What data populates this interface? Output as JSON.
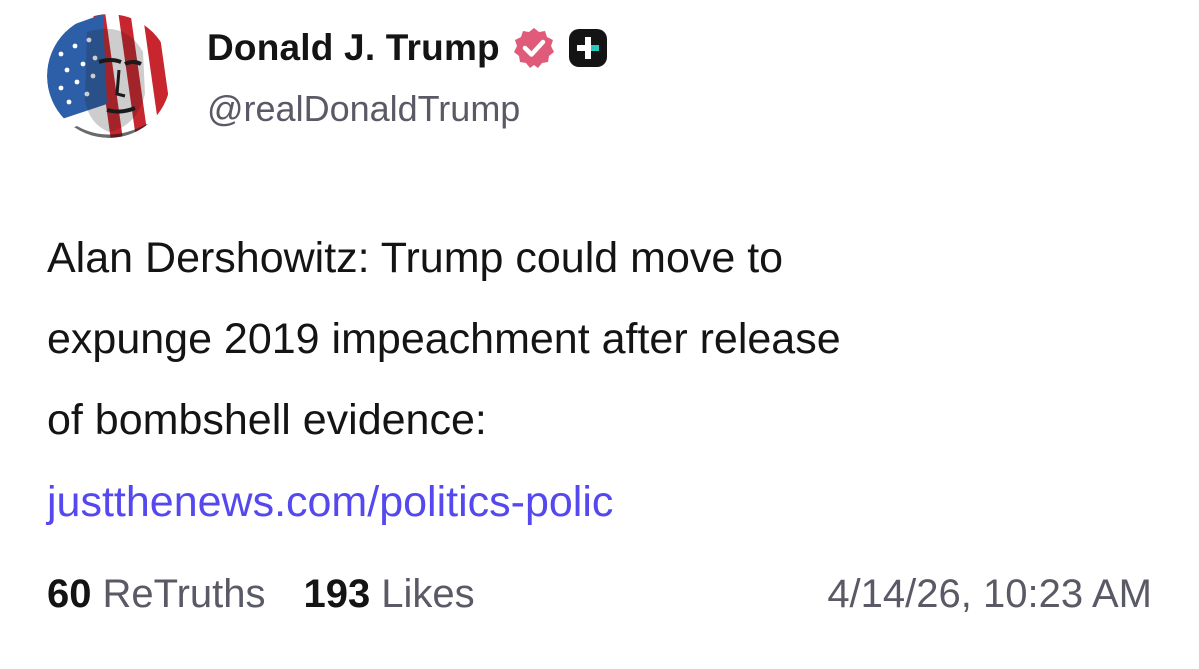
{
  "author": {
    "display_name": "Donald J. Trump",
    "handle": "@realDonaldTrump",
    "avatar_icon": "flag-portrait-avatar",
    "verified_icon": "verified-badge-icon",
    "plus_icon": "truth-plus-icon"
  },
  "post": {
    "lines": [
      "Alan Dershowitz: Trump could move to",
      "expunge 2019 impeachment after release",
      "of bombshell evidence:"
    ],
    "link_text": "justthenews.com/politics-polic"
  },
  "stats": {
    "retruths_count": "60",
    "retruths_label": "ReTruths",
    "likes_count": "193",
    "likes_label": "Likes",
    "timestamp": "4/14/26, 10:23 AM"
  },
  "colors": {
    "text": "#141414",
    "muted": "#5a5a66",
    "link": "#5448ee",
    "verified": "#e05a79",
    "badge_dark": "#141414",
    "badge_accent": "#28c9c0"
  }
}
